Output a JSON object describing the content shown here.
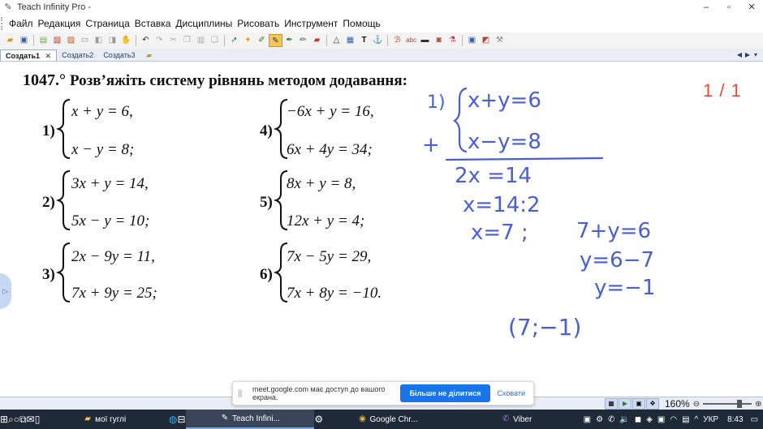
{
  "window": {
    "title": "Teach Infinity Pro -",
    "controls": [
      "–",
      "▫",
      "✕"
    ]
  },
  "menu": [
    "Файл",
    "Редакция",
    "Страница",
    "Вставка",
    "Дисциплины",
    "Рисовать",
    "Инструмент",
    "Помощь"
  ],
  "tabs": [
    {
      "label": "Создать1",
      "active": true
    },
    {
      "label": "Создать2",
      "active": false
    },
    {
      "label": "Создать3",
      "active": false
    }
  ],
  "tab_close": "✕",
  "tab_nav": [
    "◀",
    "▶",
    "▾"
  ],
  "page_counter": "1 / 1",
  "textbook": {
    "number": "1047.°",
    "instruction": "Розв’яжіть систему рівнянь методом додавання:",
    "problems": [
      {
        "num": "1)",
        "eq1": "x + y = 6,",
        "eq2": "x − y = 8;"
      },
      {
        "num": "2)",
        "eq1": "3x + y = 14,",
        "eq2": "5x − y = 10;"
      },
      {
        "num": "3)",
        "eq1": "2x − 9y = 11,",
        "eq2": "7x + 9y = 25;"
      },
      {
        "num": "4)",
        "eq1": "−6x + y = 16,",
        "eq2": "6x + 4y = 34;"
      },
      {
        "num": "5)",
        "eq1": "8x + y = 8,",
        "eq2": "12x + y = 4;"
      },
      {
        "num": "6)",
        "eq1": "7x − 5y = 29,",
        "eq2": "7x + 8y = −10."
      }
    ]
  },
  "handwriting": {
    "label": "1)",
    "eq1": "x+y=6",
    "plus": "+",
    "eq2": "x−y=8",
    "line3": "2x  =14",
    "line4": "x=14:2",
    "line5a": "x=7 ;",
    "line5b": "7+y=6",
    "line6": "y=6−7",
    "line7": "y=−1",
    "answer": "(7;−1)"
  },
  "share_notice": {
    "message": "meet.google.com має доступ до вашого екрана.",
    "stop_label": "Більше не ділитися",
    "hide_label": "Сховати"
  },
  "zoom": {
    "value": "160%",
    "minus": "⊖",
    "plus": "⊕",
    "level_percent": 160
  },
  "taskbar": {
    "apps": [
      {
        "label": "мої гуглі",
        "icon": "folder-icon"
      },
      {
        "label": "Teach Infini...",
        "icon": "teach-infinity-icon",
        "active": true
      },
      {
        "label": "Google Chr...",
        "icon": "chrome-icon"
      },
      {
        "label": "Viber",
        "icon": "viber-icon"
      }
    ],
    "lang": "УКР",
    "time": "8:43"
  },
  "colors": {
    "ink": "#4a5fd0",
    "counter": "#ea4a3a",
    "share_button": "#1a73e8",
    "taskbar": "#1f2a38"
  }
}
